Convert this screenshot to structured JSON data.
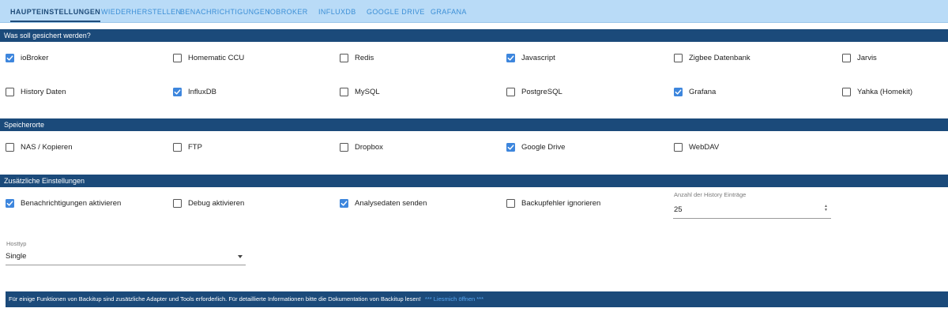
{
  "tabs": [
    {
      "label": "HAUPTEINSTELLUNGEN",
      "active": true
    },
    {
      "label": "WIEDERHERSTELLEN",
      "active": false
    },
    {
      "label": "BENACHRICHTIGUNGEN",
      "active": false
    },
    {
      "label": "IOBROKER",
      "active": false
    },
    {
      "label": "INFLUXDB",
      "active": false
    },
    {
      "label": "GOOGLE DRIVE",
      "active": false
    },
    {
      "label": "GRAFANA",
      "active": false
    }
  ],
  "backup_section": {
    "title": "Was soll gesichert werden?",
    "items": [
      {
        "label": "ioBroker",
        "checked": true
      },
      {
        "label": "Homematic CCU",
        "checked": false
      },
      {
        "label": "Redis",
        "checked": false
      },
      {
        "label": "Javascript",
        "checked": true
      },
      {
        "label": "Zigbee Datenbank",
        "checked": false
      },
      {
        "label": "Jarvis",
        "checked": false
      },
      {
        "label": "History Daten",
        "checked": false
      },
      {
        "label": "InfluxDB",
        "checked": true
      },
      {
        "label": "MySQL",
        "checked": false
      },
      {
        "label": "PostgreSQL",
        "checked": false
      },
      {
        "label": "Grafana",
        "checked": true
      },
      {
        "label": "Yahka (Homekit)",
        "checked": false
      }
    ]
  },
  "storage_section": {
    "title": "Speicherorte",
    "items": [
      {
        "label": "NAS / Kopieren",
        "checked": false
      },
      {
        "label": "FTP",
        "checked": false
      },
      {
        "label": "Dropbox",
        "checked": false
      },
      {
        "label": "Google Drive",
        "checked": true
      },
      {
        "label": "WebDAV",
        "checked": false
      }
    ]
  },
  "extra_section": {
    "title": "Zusätzliche Einstellungen",
    "items": [
      {
        "label": "Benachrichtigungen aktivieren",
        "checked": true
      },
      {
        "label": "Debug aktivieren",
        "checked": false
      },
      {
        "label": "Analysedaten senden",
        "checked": true
      },
      {
        "label": "Backupfehler ignorieren",
        "checked": false
      }
    ],
    "history_count": {
      "label": "Anzahl der History Einträge",
      "value": "25"
    },
    "host_type": {
      "label": "Hosttyp",
      "value": "Single"
    }
  },
  "info": {
    "text": "Für einige Funktionen von Backitup sind zusätzliche Adapter und Tools erforderlich. Für detaillierte Informationen bitte die Dokumentation von Backitup lesen!",
    "link": "*** Liesmich öffnen ***"
  },
  "colors": {
    "section_bar": "#1b4a7a",
    "tab_bar": "#b9dbf7",
    "checkbox_checked": "#3d86dd",
    "link": "#58a6f0"
  }
}
